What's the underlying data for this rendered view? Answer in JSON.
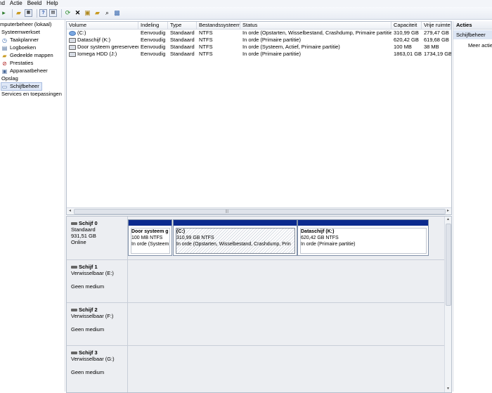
{
  "menu": {
    "items": [
      "nd",
      "Actie",
      "Beeld",
      "Help"
    ]
  },
  "toolbar": {
    "icons": [
      "back-arrow-icon",
      "folder-up-icon",
      "console-tree-icon",
      "help-icon",
      "list-view-icon",
      "refresh-icon",
      "delete-icon",
      "properties-icon",
      "open-folder-icon",
      "search-icon",
      "export-icon"
    ]
  },
  "tree": {
    "items": [
      {
        "label": "mputerbeheer (lokaal)",
        "icon": "",
        "indent": 0
      },
      {
        "label": "Systeemwerkset",
        "icon": "",
        "indent": 0
      },
      {
        "label": "Taakplanner",
        "icon": "◷",
        "indent": 1
      },
      {
        "label": "Logboeken",
        "icon": "▤",
        "indent": 1
      },
      {
        "label": "Gedeelde mappen",
        "icon": "▰",
        "indent": 1
      },
      {
        "label": "Prestaties",
        "icon": "⊘",
        "indent": 1
      },
      {
        "label": "Apparaatbeheer",
        "icon": "▣",
        "indent": 1
      },
      {
        "label": "Opslag",
        "icon": "",
        "indent": 0
      },
      {
        "label": "Schijfbeheer",
        "icon": "▭",
        "indent": 1,
        "selected": true
      },
      {
        "label": "Services en toepassingen",
        "icon": "",
        "indent": 0
      }
    ]
  },
  "volumes": {
    "columns": [
      "Volume",
      "Indeling",
      "Type",
      "Bestandssysteem",
      "Status",
      "Capaciteit",
      "Vrije ruimte"
    ],
    "rows": [
      {
        "volume": "(C:)",
        "indeling": "Eenvoudig",
        "type": "Standaard",
        "fs": "NTFS",
        "status": "In orde (Opstarten, Wisselbestand, Crashdump, Primaire partitie)",
        "capaciteit": "310,99 GB",
        "vrij": "279,47 GB",
        "sys": true
      },
      {
        "volume": "Dataschijf (K:)",
        "indeling": "Eenvoudig",
        "type": "Standaard",
        "fs": "NTFS",
        "status": "In orde (Primaire partitie)",
        "capaciteit": "620,42 GB",
        "vrij": "619,68 GB",
        "sys": false
      },
      {
        "volume": "Door systeem gereserveerd",
        "indeling": "Eenvoudig",
        "type": "Standaard",
        "fs": "NTFS",
        "status": "In orde (Systeem, Actief, Primaire partitie)",
        "capaciteit": "100 MB",
        "vrij": "38 MB",
        "sys": false
      },
      {
        "volume": "Iomega HDD (J:)",
        "indeling": "Eenvoudig",
        "type": "Standaard",
        "fs": "NTFS",
        "status": "In orde (Primaire partitie)",
        "capaciteit": "1863,01 GB",
        "vrij": "1734,19 GB",
        "sys": false
      }
    ]
  },
  "disks": [
    {
      "name": "Schijf 0",
      "line1": "Standaard",
      "line2": "931,51 GB",
      "line3": "Online",
      "partitions": [
        {
          "name": "Door systeem g",
          "size": "100 MB NTFS",
          "status": "In orde (Systeem"
        },
        {
          "name": "(C:)",
          "size": "310,99 GB NTFS",
          "status": "In orde (Opstarten, Wisselbestand, Crashdump, Prin",
          "selected": true
        },
        {
          "name": "Dataschijf  (K:)",
          "size": "620,42 GB NTFS",
          "status": "In orde (Primaire partitie)"
        }
      ]
    },
    {
      "name": "Schijf 1",
      "line1": "Verwisselbaar (E:)",
      "line2": "",
      "line3": "Geen medium",
      "partitions": []
    },
    {
      "name": "Schijf 2",
      "line1": "Verwisselbaar (F:)",
      "line2": "",
      "line3": "Geen medium",
      "partitions": []
    },
    {
      "name": "Schijf 3",
      "line1": "Verwisselbaar (G:)",
      "line2": "",
      "line3": "Geen medium",
      "partitions": []
    }
  ],
  "actions": {
    "header": "Acties",
    "section": "Schijfbeheer",
    "link": "Meer acties"
  },
  "colors": {
    "partition_bar": "#0b2a8e",
    "selected_bg": "#dde6f4"
  }
}
